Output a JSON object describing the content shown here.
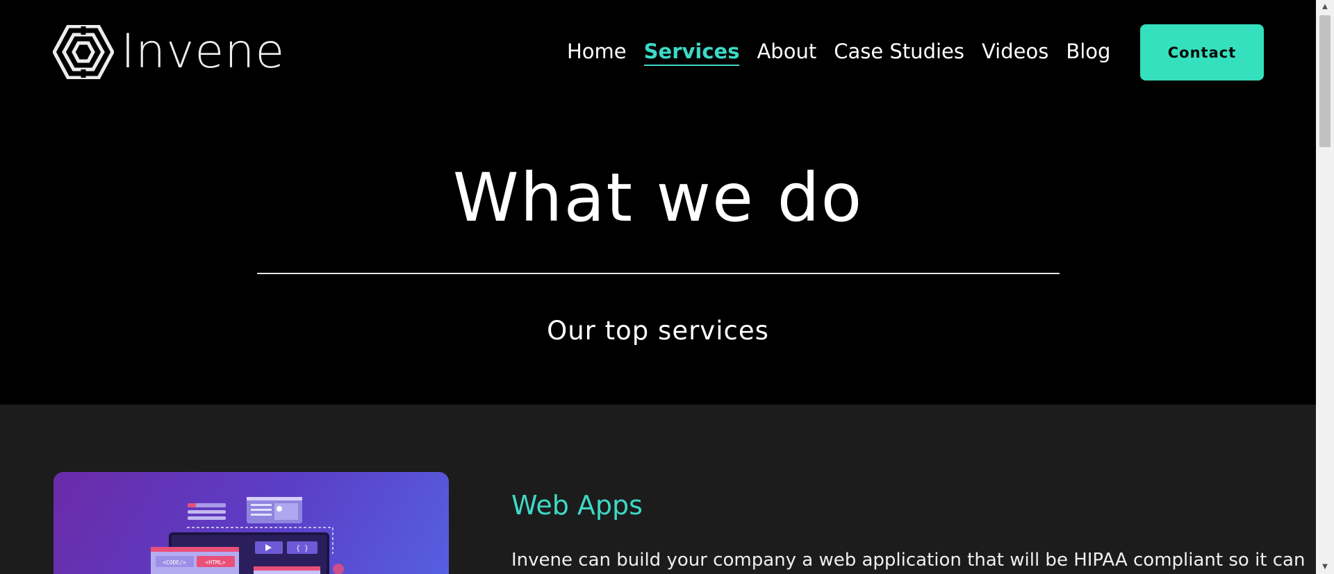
{
  "brand": {
    "name": "Invene",
    "logo_icon": "hexagon-logo-icon"
  },
  "nav": {
    "items": [
      {
        "label": "Home"
      },
      {
        "label": "Services",
        "active": true
      },
      {
        "label": "About"
      },
      {
        "label": "Case Studies"
      },
      {
        "label": "Videos"
      },
      {
        "label": "Blog"
      }
    ],
    "contact_label": "Contact"
  },
  "hero": {
    "title": "What we do",
    "subtitle": "Our top services"
  },
  "services": [
    {
      "title": "Web Apps",
      "description": "Invene can build your company a web application that will be HIPAA compliant so it can",
      "image_icon": "web-app-illustration"
    }
  ],
  "colors": {
    "accent": "#3dd9c6",
    "button": "#34e0bd",
    "background": "#000000",
    "section_background": "#1c1c1c",
    "card_gradient_start": "#6a2ba8",
    "card_gradient_end": "#5560e0"
  },
  "scrollbar": {
    "up_icon": "scroll-up-arrow-icon",
    "down_icon": "scroll-down-arrow-icon"
  }
}
